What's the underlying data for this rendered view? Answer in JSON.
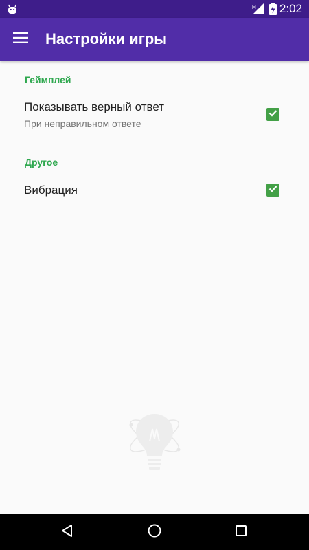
{
  "status_bar": {
    "time": "2:02",
    "icons": [
      "android-icon",
      "signal-h-icon",
      "battery-charging-icon"
    ]
  },
  "app_bar": {
    "title": "Настройки игры",
    "menu_icon": "hamburger-menu-icon",
    "background_color": "#512da8"
  },
  "sections": [
    {
      "header": "Геймплей",
      "items": [
        {
          "title": "Показывать верный ответ",
          "summary": "При неправильном ответе",
          "checked": true
        }
      ]
    },
    {
      "header": "Другое",
      "items": [
        {
          "title": "Вибрация",
          "checked": true
        }
      ]
    }
  ],
  "colors": {
    "accent": "#2fa84f",
    "checkbox": "#43a047",
    "status_bar": "#3e1d8a"
  },
  "watermark_icon": "lightbulb-atom-icon",
  "nav_bar": {
    "icons": [
      "back-icon",
      "home-icon",
      "recents-icon"
    ]
  }
}
